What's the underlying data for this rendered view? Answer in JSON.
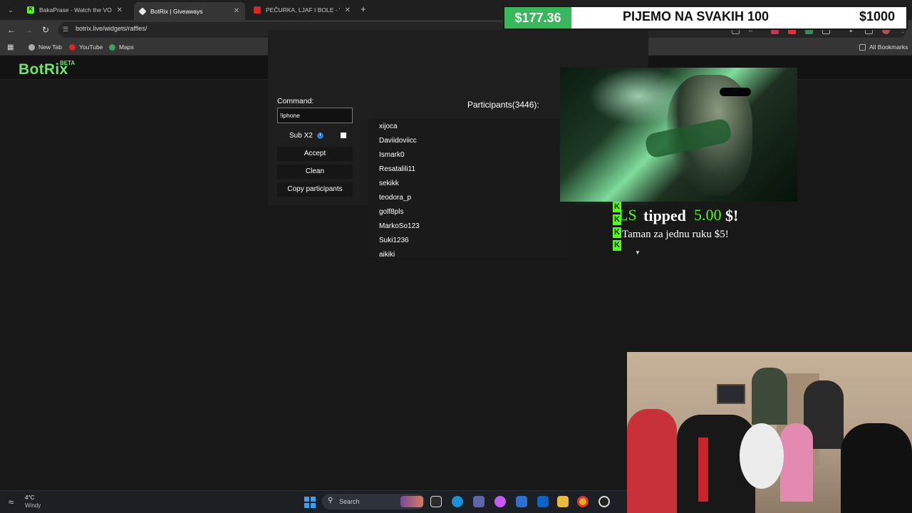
{
  "browser": {
    "tabs": [
      {
        "label": "BakaPrase - Watch the VOD on",
        "active": false
      },
      {
        "label": "BotRix | Giveaways",
        "active": true
      },
      {
        "label": "PEČURKA, LJAF I BOLE - VOSTO",
        "active": false
      }
    ],
    "url": "botrix.live/widgets/raffles/",
    "bookmarks": [
      "New Tab",
      "YouTube",
      "Maps"
    ],
    "all_bookmarks": "All Bookmarks"
  },
  "app": {
    "logo": "BotRix",
    "logo_badge": "BETA"
  },
  "raffle": {
    "command_label": "Command:",
    "command_value": "!iphone",
    "sub_label": "Sub X2",
    "sub_checked": false,
    "buttons": {
      "accept": "Accept",
      "clean": "Clean",
      "copy": "Copy participants"
    },
    "participants_title": "Participants(3446):",
    "participants": [
      "xijoca",
      "Daviidoviicc",
      "Ismark0",
      "Resatalili11",
      "sekikk",
      "teodora_p",
      "golf8pls",
      "MarkoSo123",
      "Suki1236",
      "aikiki"
    ]
  },
  "donation_bar": {
    "current": "$177.36",
    "text": "PIJEMO NA SVAKIH 100",
    "goal": "$1000"
  },
  "tip_alert": {
    "name": "LS",
    "word": "tipped",
    "amount": "5.00",
    "currency": "$!",
    "message": "Taman za jednu ruku $5!",
    "badge": "K"
  },
  "taskbar": {
    "weather_temp": "4°C",
    "weather_desc": "Windy",
    "search_placeholder": "Search"
  },
  "colors": {
    "brand_green": "#6fe66b",
    "kick_green": "#53fc18",
    "donation_green": "#38b85a"
  }
}
